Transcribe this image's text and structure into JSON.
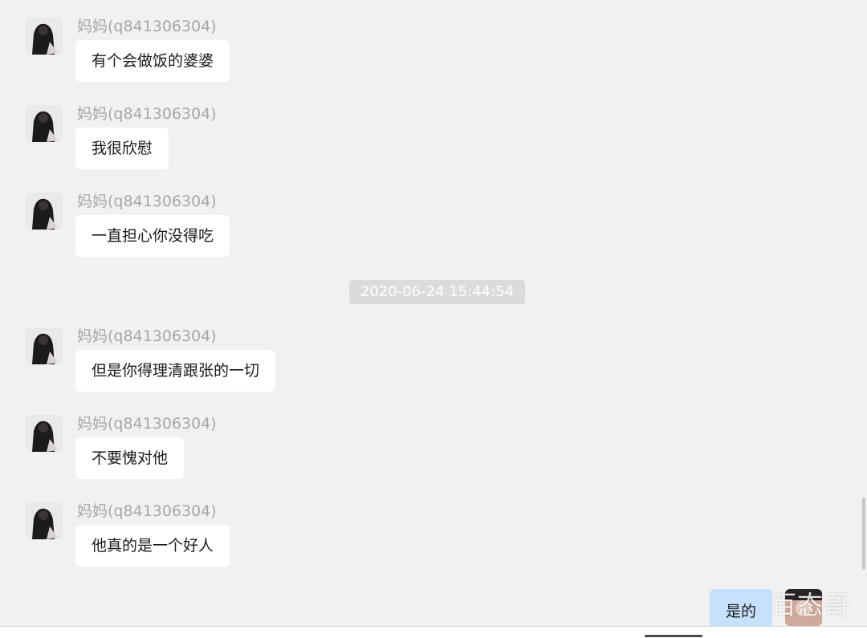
{
  "conversation": {
    "sender_name": "妈妈(q841306304)",
    "messages": [
      {
        "sender": "妈妈(q841306304)",
        "text": "有个会做饭的婆婆"
      },
      {
        "sender": "妈妈(q841306304)",
        "text": "我很欣慰"
      },
      {
        "sender": "妈妈(q841306304)",
        "text": "一直担心你没得吃"
      },
      {
        "sender": "妈妈(q841306304)",
        "text": "但是你得理清跟张的一切"
      },
      {
        "sender": "妈妈(q841306304)",
        "text": "不要愧对他"
      },
      {
        "sender": "妈妈(q841306304)",
        "text": "他真的是一个好人"
      }
    ],
    "timestamp": "2020-06-24 15:44:54",
    "my_reply": "是的"
  },
  "watermark": "百态哥",
  "colors": {
    "background": "#f2f1f2",
    "incoming_bubble": "#ffffff",
    "outgoing_bubble": "#c5e1fb",
    "sender_text": "#a7a6a8",
    "timestamp_bg": "#dcdbdc"
  },
  "icons": {
    "contact_avatar": "avatar-photo",
    "my_avatar": "avatar-photo"
  }
}
